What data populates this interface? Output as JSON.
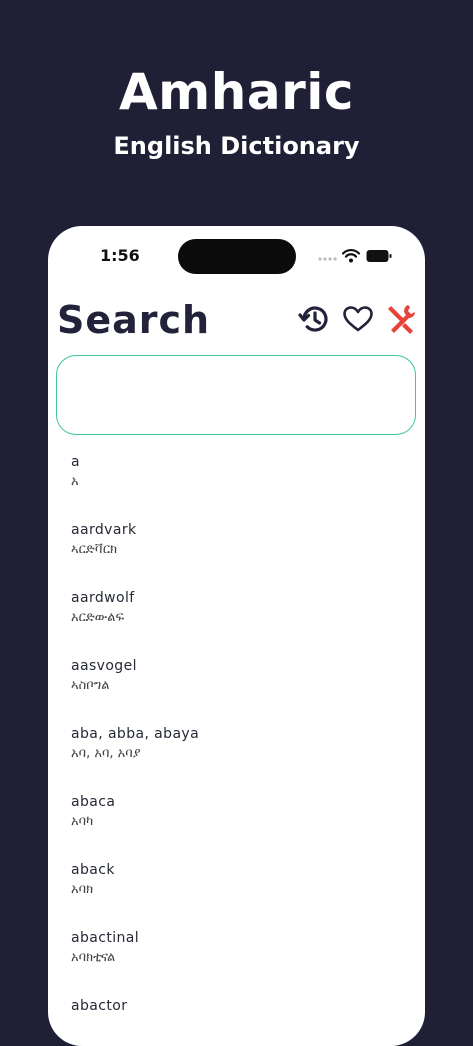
{
  "hero": {
    "title": "Amharic",
    "subtitle": "English Dictionary"
  },
  "status_bar": {
    "time": "1:56",
    "icons": [
      "signal-dots-icon",
      "wifi-icon",
      "battery-icon"
    ]
  },
  "header": {
    "title": "Search",
    "actions": [
      {
        "icon": "history-icon",
        "color": "#22223a"
      },
      {
        "icon": "heart-icon",
        "color": "#22223a"
      },
      {
        "icon": "tools-icon",
        "color": "#e8433a"
      }
    ]
  },
  "search": {
    "value": "",
    "placeholder": "",
    "border_color": "#3ec79a"
  },
  "words": [
    {
      "word": "a",
      "translation": "አ"
    },
    {
      "word": "aardvark",
      "translation": "ኣርድቫርክ"
    },
    {
      "word": "aardwolf",
      "translation": "አርድውልፍ"
    },
    {
      "word": "aasvogel",
      "translation": "ኣስቦግል"
    },
    {
      "word": "aba, abba, abaya",
      "translation": "አባ, አባ, አባያ"
    },
    {
      "word": "abaca",
      "translation": "አባካ"
    },
    {
      "word": "aback",
      "translation": "አባክ"
    },
    {
      "word": "abactinal",
      "translation": "አባክቲናል"
    },
    {
      "word": "abactor",
      "translation": ""
    }
  ],
  "colors": {
    "background": "#1f1f35",
    "text_dark": "#22223a",
    "accent_red": "#e8433a",
    "accent_green": "#3ec79a"
  }
}
